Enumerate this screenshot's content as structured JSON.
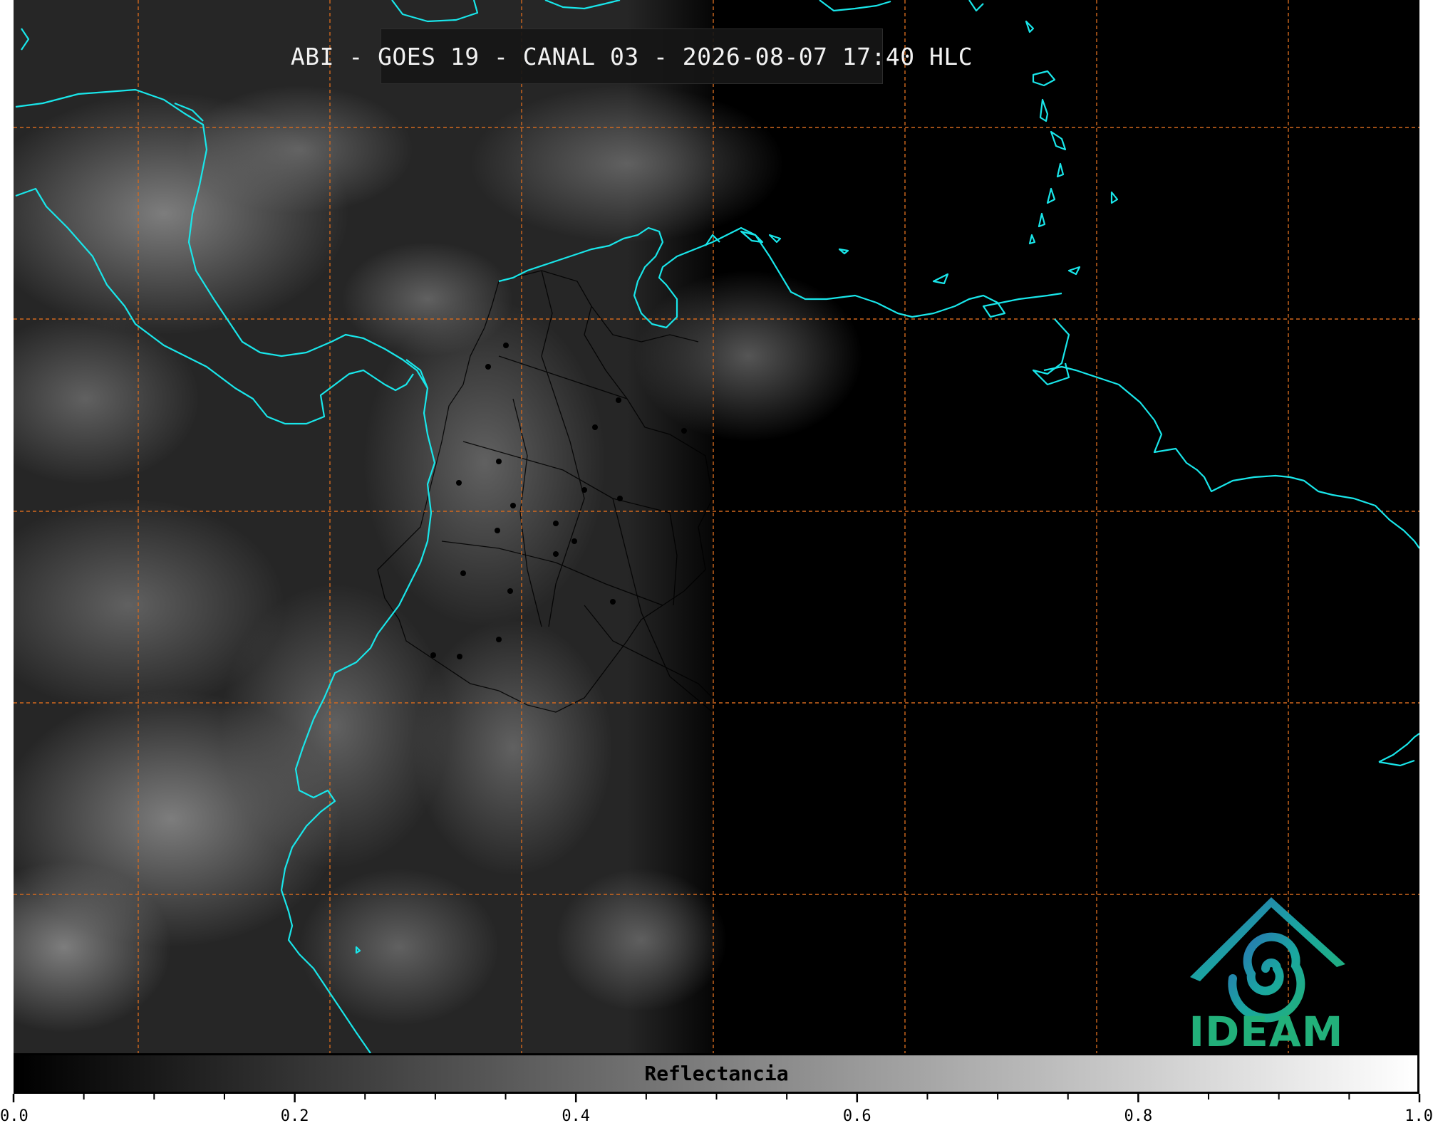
{
  "title": "ABI - GOES 19 - CANAL 03 - 2026-08-07 17:40 HLC",
  "colors": {
    "coastline": "#19e6ea",
    "gridline": "#d2691e",
    "borders": "#000000",
    "logo_blue": "#2a6fb5",
    "logo_teal": "#1aa7a0",
    "logo_green": "#22b07a"
  },
  "logo": {
    "text": "IDEAM",
    "icon": "ideam-logo-icon"
  },
  "colorbar": {
    "label": "Reflectancia",
    "range": [
      0.0,
      1.0
    ],
    "major_ticks": [
      {
        "value": 0.0,
        "label": "0.0"
      },
      {
        "value": 0.2,
        "label": "0.2"
      },
      {
        "value": 0.4,
        "label": "0.4"
      },
      {
        "value": 0.6,
        "label": "0.6"
      },
      {
        "value": 0.8,
        "label": "0.8"
      },
      {
        "value": 1.0,
        "label": "1.0"
      }
    ],
    "minor_tick_step": 0.05
  }
}
